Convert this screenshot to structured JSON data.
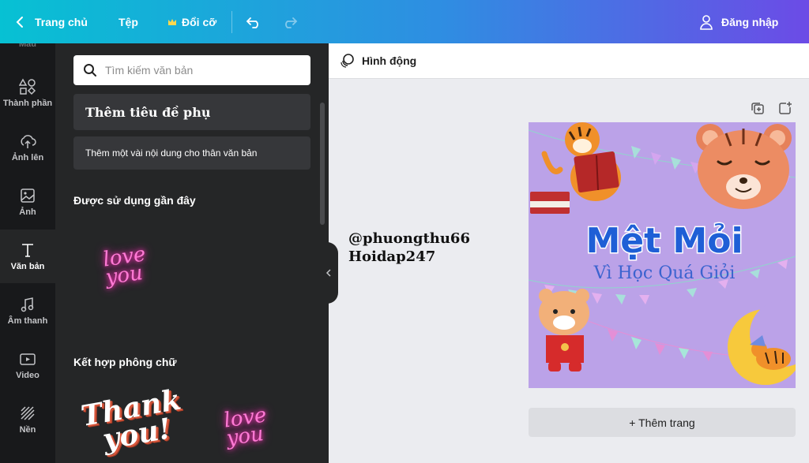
{
  "topbar": {
    "home": "Trang chủ",
    "file": "Tệp",
    "resize": "Đổi cỡ",
    "login": "Đăng nhập"
  },
  "rail": {
    "faded_label": "Màu",
    "items": [
      {
        "label": "Thành phần",
        "icon": "shapes-icon"
      },
      {
        "label": "Ảnh lên",
        "icon": "cloud-upload-icon"
      },
      {
        "label": "Ảnh",
        "icon": "image-icon"
      },
      {
        "label": "Văn bản",
        "icon": "text-icon"
      },
      {
        "label": "Âm thanh",
        "icon": "music-icon"
      },
      {
        "label": "Video",
        "icon": "video-icon"
      },
      {
        "label": "Nền",
        "icon": "background-icon"
      }
    ],
    "active": "Văn bản"
  },
  "panel": {
    "search_placeholder": "Tìm kiếm văn bản",
    "add_subheading": "Thêm tiêu đề phụ",
    "add_body": "Thêm một vài nội dung cho thân văn bản",
    "recent_title": "Được sử dụng gần đây",
    "recent_sample": "love you",
    "combos_title": "Kết hợp phông chữ",
    "combo_1_line1": "Thank",
    "combo_1_line2": "you!",
    "combo_2": "love you"
  },
  "editor": {
    "animate_label": "Hình động",
    "watermark_line1": "@phuongthu66",
    "watermark_line2": "Hoidap247",
    "design_title": "Mệt Mỏi",
    "design_subtitle": "Vì Học Quá Giỏi",
    "add_page": "+ Thêm trang"
  },
  "colors": {
    "topbar_start": "#07c1d3",
    "topbar_end": "#6c4be6",
    "rail_bg": "#18191b",
    "panel_bg": "#252627",
    "canvas_bg": "#bba2e8",
    "title_blue": "#1f5fd6",
    "neon_pink": "#ff7ad5"
  }
}
